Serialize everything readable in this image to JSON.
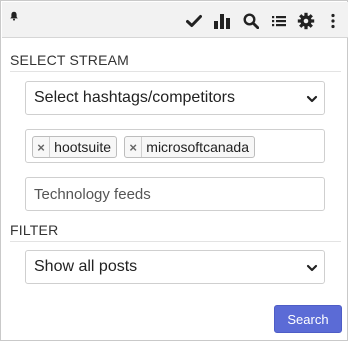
{
  "toolbar": {
    "left_icon": "bell-icon",
    "icons": [
      "check-icon",
      "bar-chart-icon",
      "search-icon",
      "list-icon",
      "gear-icon",
      "more-vertical-icon"
    ]
  },
  "select_stream": {
    "title": "SELECT STREAM",
    "dropdown_value": "Select hashtags/competitors",
    "tags": [
      "hootsuite",
      "microsoftcanada"
    ],
    "tag_remove_symbol": "×",
    "feed_input_placeholder": "Technology feeds"
  },
  "filter": {
    "title": "FILTER",
    "dropdown_value": "Show all posts"
  },
  "search_button_label": "Search",
  "colors": {
    "accent": "#5b6bd6",
    "toolbar_bg": "#f2f2f2",
    "icon": "#222222"
  }
}
